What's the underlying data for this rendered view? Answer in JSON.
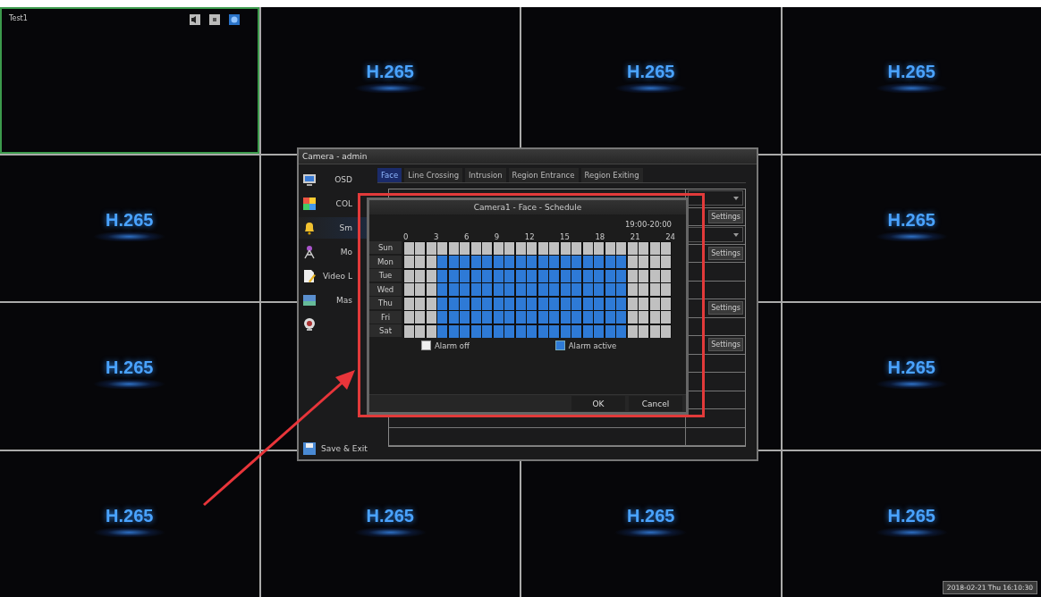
{
  "tiles": [
    {
      "kind": "camera",
      "title": "Test1",
      "selected": true
    },
    {
      "kind": "logo",
      "text": "H.265",
      "selected": false
    },
    {
      "kind": "logo",
      "text": "H.265",
      "selected": false
    },
    {
      "kind": "logo",
      "text": "H.265",
      "selected": false
    },
    {
      "kind": "logo",
      "text": "H.265",
      "selected": false
    },
    {
      "kind": "blank",
      "selected": false
    },
    {
      "kind": "blank",
      "selected": false
    },
    {
      "kind": "logo",
      "text": "H.265",
      "selected": false
    },
    {
      "kind": "logo",
      "text": "H.265",
      "selected": false
    },
    {
      "kind": "blank",
      "selected": false
    },
    {
      "kind": "blank",
      "selected": false
    },
    {
      "kind": "logo",
      "text": "H.265",
      "selected": false
    },
    {
      "kind": "logo",
      "text": "H.265",
      "selected": false
    },
    {
      "kind": "logo",
      "text": "H.265",
      "selected": false
    },
    {
      "kind": "logo",
      "text": "H.265",
      "selected": false
    },
    {
      "kind": "logo",
      "text": "H.265",
      "selected": false
    }
  ],
  "camera_dialog": {
    "title": "Camera - admin",
    "menu": [
      {
        "kind": "monitor",
        "label": "OSD",
        "selected": false
      },
      {
        "kind": "palette",
        "label": "COL",
        "selected": false
      },
      {
        "kind": "bell",
        "label": "Sm",
        "selected": true
      },
      {
        "kind": "antenna",
        "label": "Mo",
        "selected": false
      },
      {
        "kind": "document",
        "label": "Video L",
        "selected": false
      },
      {
        "kind": "frame",
        "label": "Mas",
        "selected": false
      },
      {
        "kind": "webcam",
        "selected": false
      }
    ],
    "save_label": "Save & Exit",
    "tabs": [
      {
        "label": "Face",
        "selected": true
      },
      {
        "label": "Line Crossing",
        "selected": false
      },
      {
        "label": "Intrusion",
        "selected": false
      },
      {
        "label": "Region Entrance",
        "selected": false
      },
      {
        "label": "Region Exiting",
        "selected": false
      }
    ],
    "settings_rows": [
      {
        "kind": "dropdown"
      },
      {
        "kind": "button",
        "label": "Settings"
      },
      {
        "kind": "dropdown"
      },
      {
        "kind": "button",
        "label": "Settings"
      },
      {
        "kind": "empty"
      },
      {
        "kind": "empty"
      },
      {
        "kind": "button",
        "label": "Settings"
      },
      {
        "kind": "empty"
      },
      {
        "kind": "button",
        "label": "Settings"
      },
      {
        "kind": "empty"
      },
      {
        "kind": "empty"
      },
      {
        "kind": "empty"
      },
      {
        "kind": "empty"
      },
      {
        "kind": "empty"
      }
    ]
  },
  "schedule_dialog": {
    "title": "Camera1 - Face - Schedule",
    "time_range": "19:00-20:00",
    "hour_labels": [
      "0",
      "3",
      "6",
      "9",
      "12",
      "15",
      "18",
      "21",
      "24"
    ],
    "days": [
      {
        "label": "Sun",
        "hours": [
          false,
          false,
          false,
          false,
          false,
          false,
          false,
          false,
          false,
          false,
          false,
          false,
          false,
          false,
          false,
          false,
          false,
          false,
          false,
          false,
          false,
          false,
          false,
          false
        ]
      },
      {
        "label": "Mon",
        "hours": [
          false,
          false,
          false,
          true,
          true,
          true,
          true,
          true,
          true,
          true,
          true,
          true,
          true,
          true,
          true,
          true,
          true,
          true,
          true,
          true,
          false,
          false,
          false,
          false
        ]
      },
      {
        "label": "Tue",
        "hours": [
          false,
          false,
          false,
          true,
          true,
          true,
          true,
          true,
          true,
          true,
          true,
          true,
          true,
          true,
          true,
          true,
          true,
          true,
          true,
          true,
          false,
          false,
          false,
          false
        ]
      },
      {
        "label": "Wed",
        "hours": [
          false,
          false,
          false,
          true,
          true,
          true,
          true,
          true,
          true,
          true,
          true,
          true,
          true,
          true,
          true,
          true,
          true,
          true,
          true,
          true,
          false,
          false,
          false,
          false
        ]
      },
      {
        "label": "Thu",
        "hours": [
          false,
          false,
          false,
          true,
          true,
          true,
          true,
          true,
          true,
          true,
          true,
          true,
          true,
          true,
          true,
          true,
          true,
          true,
          true,
          true,
          false,
          false,
          false,
          false
        ]
      },
      {
        "label": "Fri",
        "hours": [
          false,
          false,
          false,
          true,
          true,
          true,
          true,
          true,
          true,
          true,
          true,
          true,
          true,
          true,
          true,
          true,
          true,
          true,
          true,
          true,
          false,
          false,
          false,
          false
        ]
      },
      {
        "label": "Sat",
        "hours": [
          false,
          false,
          false,
          true,
          true,
          true,
          true,
          true,
          true,
          true,
          true,
          true,
          true,
          true,
          true,
          true,
          true,
          true,
          true,
          true,
          false,
          false,
          false,
          false
        ]
      }
    ],
    "legend": [
      {
        "label": "Alarm off",
        "active": false
      },
      {
        "label": "Alarm active",
        "active": true
      }
    ],
    "buttons": [
      "OK",
      "Cancel"
    ]
  },
  "timestamp": "2018-02-21 Thu 16:10:30"
}
